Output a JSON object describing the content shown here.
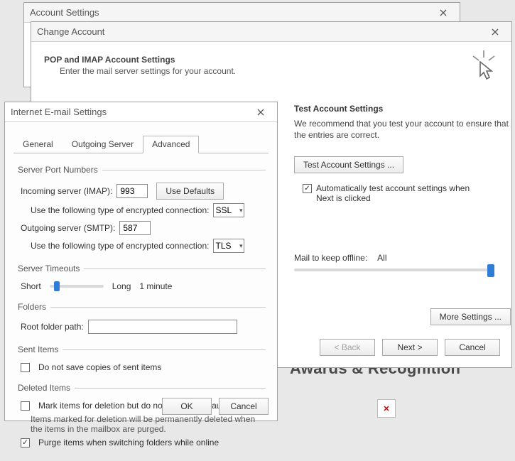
{
  "account_window": {
    "title": "Account Settings"
  },
  "change_window": {
    "title": "Change Account",
    "header_title": "POP and IMAP Account Settings",
    "header_sub": "Enter the mail server settings for your account.",
    "test_title": "Test Account Settings",
    "test_body": "We recommend that you test your account to ensure that the entries are correct.",
    "test_button": "Test Account Settings ...",
    "auto_test_label": "Automatically test account settings when Next is clicked",
    "mail_offline_label": "Mail to keep offline:",
    "mail_offline_value": "All",
    "more_settings": "More Settings ...",
    "back": "< Back",
    "next": "Next >",
    "cancel": "Cancel"
  },
  "email_dialog": {
    "title": "Internet E-mail Settings",
    "tabs": {
      "general": "General",
      "outgoing": "Outgoing Server",
      "advanced": "Advanced"
    },
    "groups": {
      "ports": "Server Port Numbers",
      "timeouts": "Server Timeouts",
      "folders": "Folders",
      "sent": "Sent Items",
      "deleted": "Deleted Items"
    },
    "incoming_label": "Incoming server (IMAP):",
    "incoming_value": "993",
    "use_defaults": "Use Defaults",
    "enc_label": "Use the following type of encrypted connection:",
    "incoming_enc": "SSL",
    "outgoing_label": "Outgoing server (SMTP):",
    "outgoing_value": "587",
    "outgoing_enc": "TLS",
    "timeout_short": "Short",
    "timeout_long": "Long",
    "timeout_value": "1 minute",
    "root_folder": "Root folder path:",
    "root_folder_value": "",
    "sent_opt": "Do not save copies of sent items",
    "del_mark": "Mark items for deletion but do not move them automatically",
    "del_note": "Items marked for deletion will be permanently deleted when the items in the mailbox are purged.",
    "del_purge": "Purge items when switching folders while online",
    "ok": "OK",
    "cancel": "Cancel"
  },
  "background": {
    "heading_fragment": "Awards & Recognition"
  }
}
